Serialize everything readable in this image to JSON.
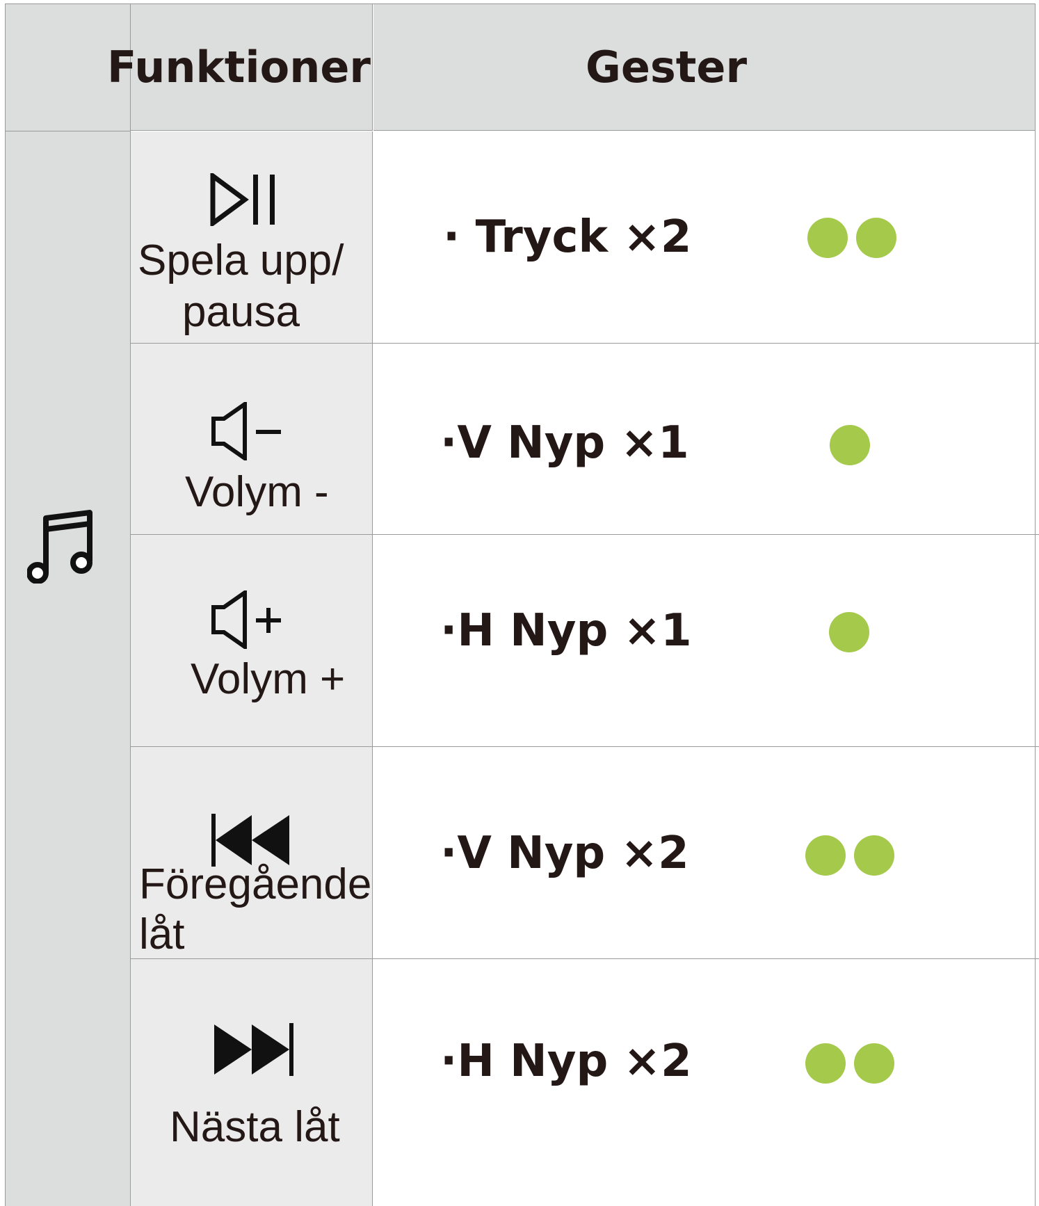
{
  "header": {
    "functions_label": "Funktioner",
    "gestures_label": "Gester"
  },
  "category": {
    "icon": "music-note-icon"
  },
  "colors": {
    "dot": "#a4c94b",
    "header_bg": "#dcdedd",
    "func_bg": "#ebebeb"
  },
  "rows": [
    {
      "icon": "play-pause-icon",
      "label_line1": "Spela upp/",
      "label_line2": "pausa",
      "gesture": "· Tryck ×2",
      "dots": 2
    },
    {
      "icon": "volume-down-icon",
      "label_line1": "Volym -",
      "gesture": "·V Nyp ×1",
      "dots": 1
    },
    {
      "icon": "volume-up-icon",
      "label_line1": "Volym +",
      "gesture": "·H Nyp ×1",
      "dots": 1
    },
    {
      "icon": "previous-track-icon",
      "label_line1": "Föregående",
      "label_line2": "låt",
      "gesture": "·V Nyp ×2",
      "dots": 2
    },
    {
      "icon": "next-track-icon",
      "label_line1": "Nästa låt",
      "gesture": "·H Nyp ×2",
      "dots": 2
    }
  ]
}
